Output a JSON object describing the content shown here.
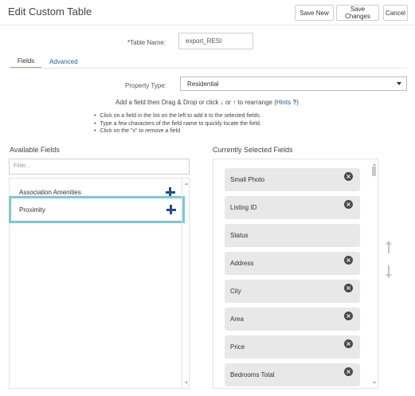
{
  "header": {
    "title": "Edit Custom Table",
    "buttons": {
      "save_new": "Save New",
      "save_changes": "Save Changes",
      "cancel": "Cancel"
    }
  },
  "table_name": {
    "required_mark": "*",
    "label": "Table Name:",
    "value": "export_RESI"
  },
  "tabs": [
    {
      "label": "Fields",
      "active": true
    },
    {
      "label": "Advanced",
      "active": false
    }
  ],
  "property_type": {
    "label": "Property Type:",
    "value": "Residential"
  },
  "instructions": {
    "main_before": "Add a field then Drag & Drop or click ↓ or ↑ to rearrange (",
    "hints_label": "Hints",
    "hints_glyph": "?",
    "main_after": ")",
    "bullets": [
      "Click on a field in the list on the left to add it to the selected fields.",
      "Type a few characters of the field name to quickly locate the field.",
      "Click on the \"x\" to remove a field"
    ]
  },
  "available_fields": {
    "title": "Available Fields",
    "filter_placeholder": "Filter...",
    "items": [
      {
        "label": "Association Amenities"
      },
      {
        "label": "Proximity",
        "highlighted": true
      }
    ]
  },
  "selected_fields": {
    "title": "Currently Selected Fields",
    "items": [
      {
        "label": "Small Photo",
        "removable": true
      },
      {
        "label": "Listing ID",
        "removable": true
      },
      {
        "label": "Status",
        "removable": false
      },
      {
        "label": "Address",
        "removable": true
      },
      {
        "label": "City",
        "removable": true
      },
      {
        "label": "Area",
        "removable": true
      },
      {
        "label": "Price",
        "removable": true
      },
      {
        "label": "Bedrooms Total",
        "removable": true
      }
    ],
    "remove_glyph": "×"
  },
  "colors": {
    "accent_tab": "#f0903a",
    "link": "#1a5fa8",
    "highlight_border": "#7fc7d6",
    "plus": "#1e4e8c"
  }
}
